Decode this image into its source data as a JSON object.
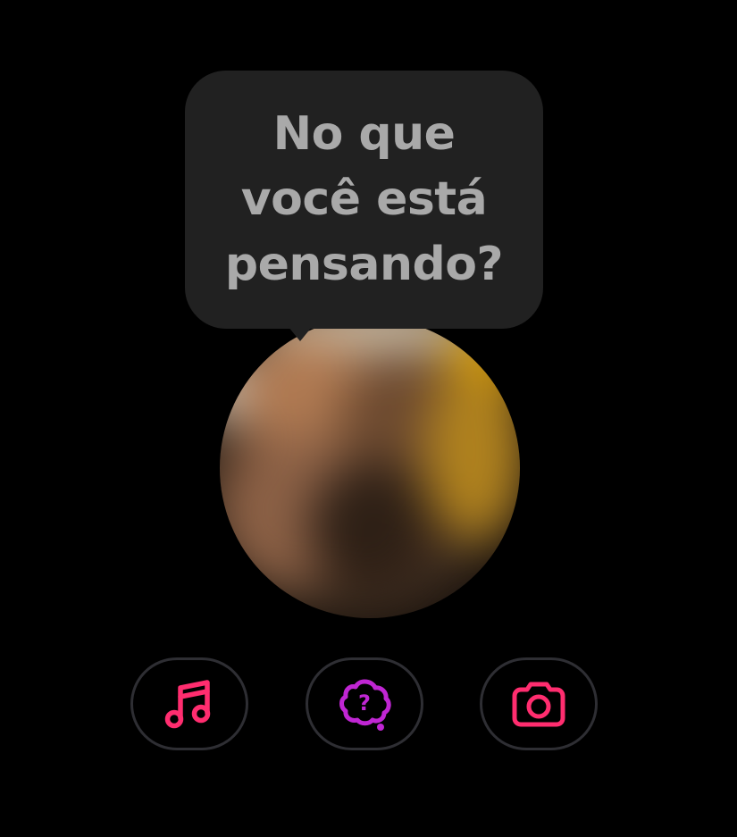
{
  "prompt": {
    "text": "No que você está pensando?"
  },
  "actions": [
    {
      "icon": "music-note-icon",
      "color": "#ff2d6f"
    },
    {
      "icon": "question-bubble-icon",
      "color": "#c026d3"
    },
    {
      "icon": "camera-icon",
      "color": "#ff2d6f"
    }
  ],
  "colors": {
    "background": "#000000",
    "bubble": "#212121",
    "bubble_text": "#a9a9a9",
    "button_border": "#2e2e33",
    "accent_pink": "#ff2d6f",
    "accent_purple": "#c026d3"
  }
}
